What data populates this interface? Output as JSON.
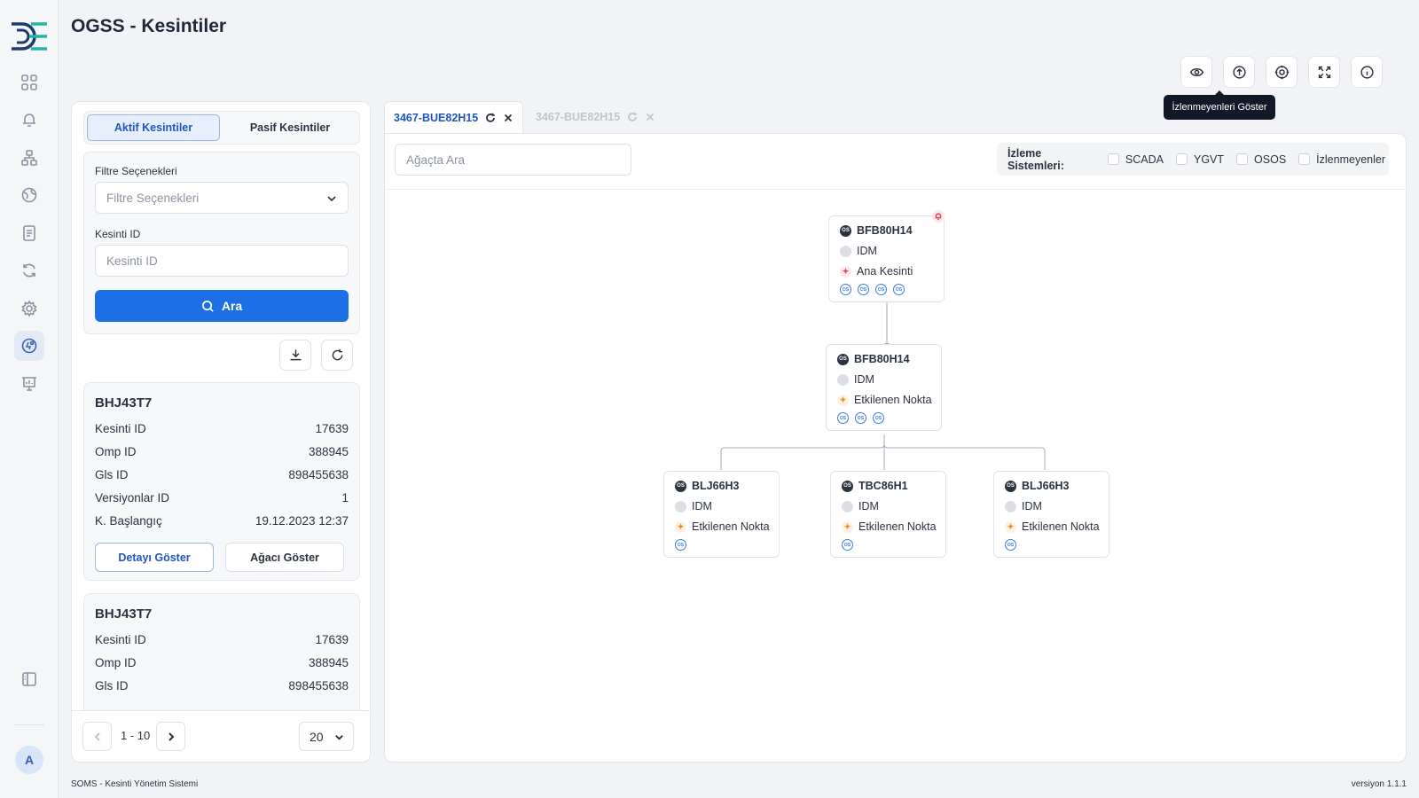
{
  "app": {
    "title": "OGSS - Kesintiler",
    "avatar_initial": "A"
  },
  "toolbar": {
    "tooltip": "İzlenmeyenleri Göster"
  },
  "left_panel": {
    "tabs": [
      {
        "label": "Aktif Kesintiler"
      },
      {
        "label": "Pasif Kesintiler"
      }
    ],
    "filter_label": "Filtre Seçenekleri",
    "filter_placeholder": "Filtre Seçenekleri",
    "id_label": "Kesinti ID",
    "id_placeholder": "Kesinti ID",
    "search_label": "Ara",
    "cards": [
      {
        "title": "BHJ43T7",
        "rows": [
          {
            "label": "Kesinti ID",
            "value": "17639"
          },
          {
            "label": "Omp ID",
            "value": "388945"
          },
          {
            "label": "Gls ID",
            "value": "898455638"
          },
          {
            "label": "Versiyonlar ID",
            "value": "1"
          },
          {
            "label": "K. Başlangıç",
            "value": "19.12.2023 12:37"
          }
        ],
        "detail_label": "Detayı Göster",
        "tree_label": "Ağacı Göster"
      },
      {
        "title": "BHJ43T7",
        "rows": [
          {
            "label": "Kesinti ID",
            "value": "17639"
          },
          {
            "label": "Omp ID",
            "value": "388945"
          },
          {
            "label": "Gls ID",
            "value": "898455638"
          }
        ]
      }
    ],
    "pager": {
      "range": "1 - 10",
      "page_size": "20"
    }
  },
  "tabs": [
    {
      "label": "3467-BUE82H15"
    },
    {
      "label": "3467-BUE82H15"
    }
  ],
  "main": {
    "search_placeholder": "Ağaçta Ara",
    "monitor_title": "İzleme Sistemleri:",
    "monitor_options": [
      "SCADA",
      "YGVT",
      "OSOS",
      "İzlenmeyenler"
    ],
    "os_badge": "OS",
    "nodes": [
      {
        "id": "BFB80H14",
        "system": "IDM",
        "type": "Ana Kesinti",
        "os_count": 4,
        "alarm": true
      },
      {
        "id": "BFB80H14",
        "system": "IDM",
        "type": "Etkilenen Nokta",
        "os_count": 3
      },
      {
        "id": "BLJ66H3",
        "system": "IDM",
        "type": "Etkilenen Nokta",
        "os_count": 1
      },
      {
        "id": "TBC86H1",
        "system": "IDM",
        "type": "Etkilenen Nokta",
        "os_count": 1
      },
      {
        "id": "BLJ66H3",
        "system": "IDM",
        "type": "Etkilenen Nokta",
        "os_count": 1
      }
    ]
  },
  "footer": {
    "left": "SOMS - Kesinti Yönetim Sistemi",
    "right": "versiyon 1.1.1"
  },
  "colors": {
    "accent": "#1d6fe6",
    "alarm": "#e04757",
    "affected": "#f08a1c"
  }
}
